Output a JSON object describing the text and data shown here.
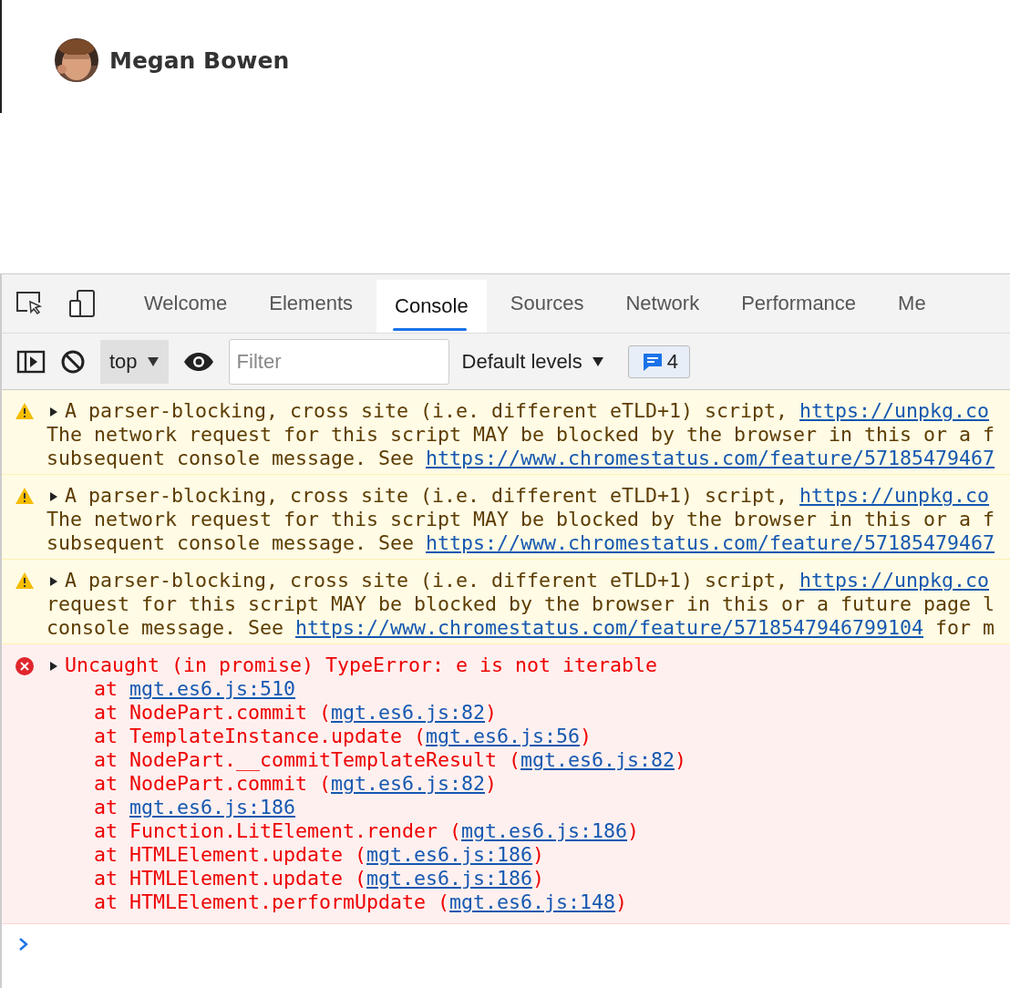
{
  "person": {
    "name": "Megan Bowen"
  },
  "tabs": [
    {
      "label": "Welcome",
      "selected": false
    },
    {
      "label": "Elements",
      "selected": false
    },
    {
      "label": "Console",
      "selected": true
    },
    {
      "label": "Sources",
      "selected": false
    },
    {
      "label": "Network",
      "selected": false
    },
    {
      "label": "Performance",
      "selected": false
    },
    {
      "label": "Me",
      "selected": false
    }
  ],
  "toolbar": {
    "context": "top",
    "filter_placeholder": "Filter",
    "levels": "Default levels",
    "message_count": "4"
  },
  "messages": [
    {
      "kind": "warning",
      "lines": [
        [
          {
            "kind": "text",
            "text": "A parser-blocking, cross site (i.e. different eTLD+1) script, "
          },
          {
            "kind": "link",
            "text": "https://unpkg.co"
          }
        ],
        [
          {
            "kind": "text",
            "text": "The network request for this script MAY be blocked by the browser in this or a f"
          }
        ],
        [
          {
            "kind": "text",
            "text": "subsequent console message. See "
          },
          {
            "kind": "link",
            "text": "https://www.chromestatus.com/feature/57185479467"
          }
        ]
      ]
    },
    {
      "kind": "warning",
      "lines": [
        [
          {
            "kind": "text",
            "text": "A parser-blocking, cross site (i.e. different eTLD+1) script, "
          },
          {
            "kind": "link",
            "text": "https://unpkg.co"
          }
        ],
        [
          {
            "kind": "text",
            "text": "The network request for this script MAY be blocked by the browser in this or a f"
          }
        ],
        [
          {
            "kind": "text",
            "text": "subsequent console message. See "
          },
          {
            "kind": "link",
            "text": "https://www.chromestatus.com/feature/57185479467"
          }
        ]
      ]
    },
    {
      "kind": "warning",
      "lines": [
        [
          {
            "kind": "text",
            "text": "A parser-blocking, cross site (i.e. different eTLD+1) script, "
          },
          {
            "kind": "link",
            "text": "https://unpkg.co"
          }
        ],
        [
          {
            "kind": "text",
            "text": "request for this script MAY be blocked by the browser in this or a future page l"
          }
        ],
        [
          {
            "kind": "text",
            "text": "console message. See "
          },
          {
            "kind": "link",
            "text": "https://www.chromestatus.com/feature/5718547946799104"
          },
          {
            "kind": "text",
            "text": " for m"
          }
        ]
      ]
    },
    {
      "kind": "error",
      "lines": [
        [
          {
            "kind": "text",
            "text": "Uncaught (in promise) TypeError: e is not iterable"
          }
        ],
        [
          {
            "kind": "text",
            "text": "    at "
          },
          {
            "kind": "link",
            "text": "mgt.es6.js:510"
          }
        ],
        [
          {
            "kind": "text",
            "text": "    at NodePart.commit ("
          },
          {
            "kind": "link",
            "text": "mgt.es6.js:82"
          },
          {
            "kind": "text",
            "text": ")"
          }
        ],
        [
          {
            "kind": "text",
            "text": "    at TemplateInstance.update ("
          },
          {
            "kind": "link",
            "text": "mgt.es6.js:56"
          },
          {
            "kind": "text",
            "text": ")"
          }
        ],
        [
          {
            "kind": "text",
            "text": "    at NodePart.__commitTemplateResult ("
          },
          {
            "kind": "link",
            "text": "mgt.es6.js:82"
          },
          {
            "kind": "text",
            "text": ")"
          }
        ],
        [
          {
            "kind": "text",
            "text": "    at NodePart.commit ("
          },
          {
            "kind": "link",
            "text": "mgt.es6.js:82"
          },
          {
            "kind": "text",
            "text": ")"
          }
        ],
        [
          {
            "kind": "text",
            "text": "    at "
          },
          {
            "kind": "link",
            "text": "mgt.es6.js:186"
          }
        ],
        [
          {
            "kind": "text",
            "text": "    at Function.LitElement.render ("
          },
          {
            "kind": "link",
            "text": "mgt.es6.js:186"
          },
          {
            "kind": "text",
            "text": ")"
          }
        ],
        [
          {
            "kind": "text",
            "text": "    at HTMLElement.update ("
          },
          {
            "kind": "link",
            "text": "mgt.es6.js:186"
          },
          {
            "kind": "text",
            "text": ")"
          }
        ],
        [
          {
            "kind": "text",
            "text": "    at HTMLElement.update ("
          },
          {
            "kind": "link",
            "text": "mgt.es6.js:186"
          },
          {
            "kind": "text",
            "text": ")"
          }
        ],
        [
          {
            "kind": "text",
            "text": "    at HTMLElement.performUpdate ("
          },
          {
            "kind": "link",
            "text": "mgt.es6.js:148"
          },
          {
            "kind": "text",
            "text": ")"
          }
        ]
      ]
    }
  ]
}
